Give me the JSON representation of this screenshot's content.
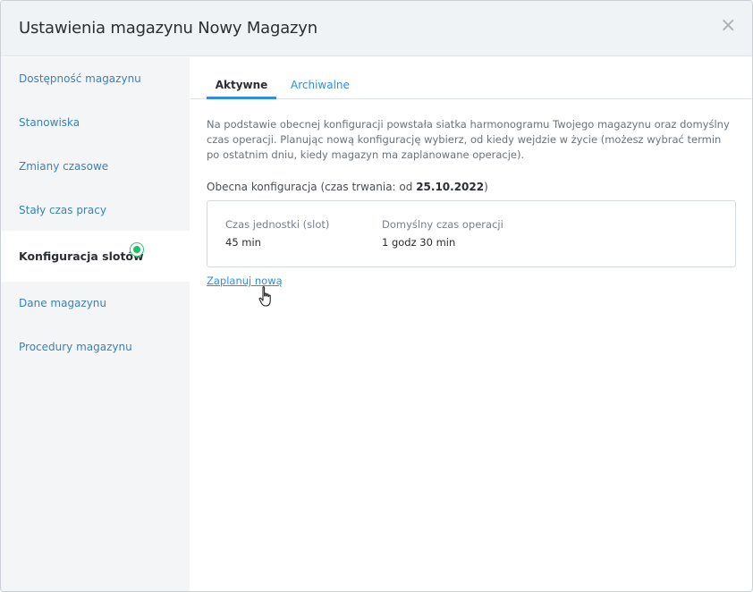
{
  "dialog": {
    "title": "Ustawienia magazynu Nowy Magazyn",
    "close_glyph": "×"
  },
  "sidebar": {
    "items": [
      {
        "label": "Dostępność magazynu",
        "active": false
      },
      {
        "label": "Stanowiska",
        "active": false
      },
      {
        "label": "Zmiany czasowe",
        "active": false
      },
      {
        "label": "Stały czas pracy",
        "active": false
      },
      {
        "label": "Konfiguracja slotów",
        "active": true
      },
      {
        "label": "Dane magazynu",
        "active": false
      },
      {
        "label": "Procedury magazynu",
        "active": false
      }
    ],
    "active_indicator_color": "#1fbf6a"
  },
  "tabs": [
    {
      "label": "Aktywne",
      "active": true
    },
    {
      "label": "Archiwalne",
      "active": false
    }
  ],
  "main": {
    "description": "Na podstawie obecnej konfiguracji powstała siatka harmonogramu Twojego magazynu oraz domyślny czas operacji. Planując nową konfigurację wybierz, od kiedy wejdzie w życie (możesz wybrać termin po ostatnim dniu, kiedy magazyn ma zaplanowane operacje).",
    "current_prefix": "Obecna konfiguracja (czas trwania: od ",
    "current_date": "25.10.2022",
    "current_suffix": ")",
    "card": {
      "slot_label": "Czas jednostki (slot)",
      "slot_value": "45 min",
      "operation_label": "Domyślny czas operacji",
      "operation_value": "1 godz 30 min"
    },
    "plan_link": "Zaplanuj nową"
  },
  "colors": {
    "accent": "#2f8de4",
    "sidebar_link": "#3c82b4",
    "header_bg": "#f0f3f5",
    "sidebar_bg": "#f3f5f7"
  }
}
